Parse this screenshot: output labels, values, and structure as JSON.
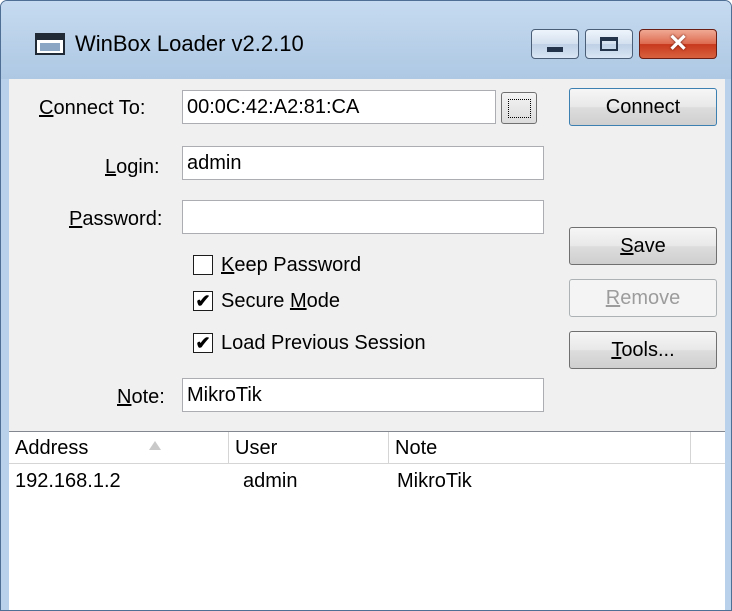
{
  "window": {
    "title": "WinBox Loader v2.2.10",
    "controls": [
      "minimize",
      "maximize",
      "close"
    ]
  },
  "form": {
    "connect_to": {
      "label_pre": "",
      "label_key": "C",
      "label_post": "onnect To:",
      "value": "00:0C:42:A2:81:CA"
    },
    "login": {
      "label_key": "L",
      "label_post": "ogin:",
      "value": "admin"
    },
    "password": {
      "label_key": "P",
      "label_post": "assword:",
      "value": ""
    },
    "note": {
      "label_key": "N",
      "label_post": "ote:",
      "value": "MikroTik"
    }
  },
  "checkboxes": {
    "keep_password": {
      "pre": "",
      "key": "K",
      "post": "eep Password",
      "checked": false
    },
    "secure_mode": {
      "pre": "Secure ",
      "key": "M",
      "post": "ode",
      "checked": true
    },
    "load_previous_session": {
      "pre": "Load Previous Session",
      "key": "",
      "post": "",
      "checked": true
    }
  },
  "buttons": {
    "connect": "Connect",
    "save": {
      "key": "S",
      "post": "ave"
    },
    "remove": {
      "key": "R",
      "post": "emove",
      "disabled": true
    },
    "tools": {
      "key": "T",
      "post": "ools..."
    }
  },
  "list": {
    "columns": [
      "Address",
      "User",
      "Note"
    ],
    "rows": [
      {
        "address": "192.168.1.2",
        "user": "admin",
        "note": "MikroTik"
      }
    ]
  },
  "colors": {
    "title_bar": "#b9d1ea",
    "close_button": "#c8391c",
    "client_bg": "#f0f0f0"
  }
}
